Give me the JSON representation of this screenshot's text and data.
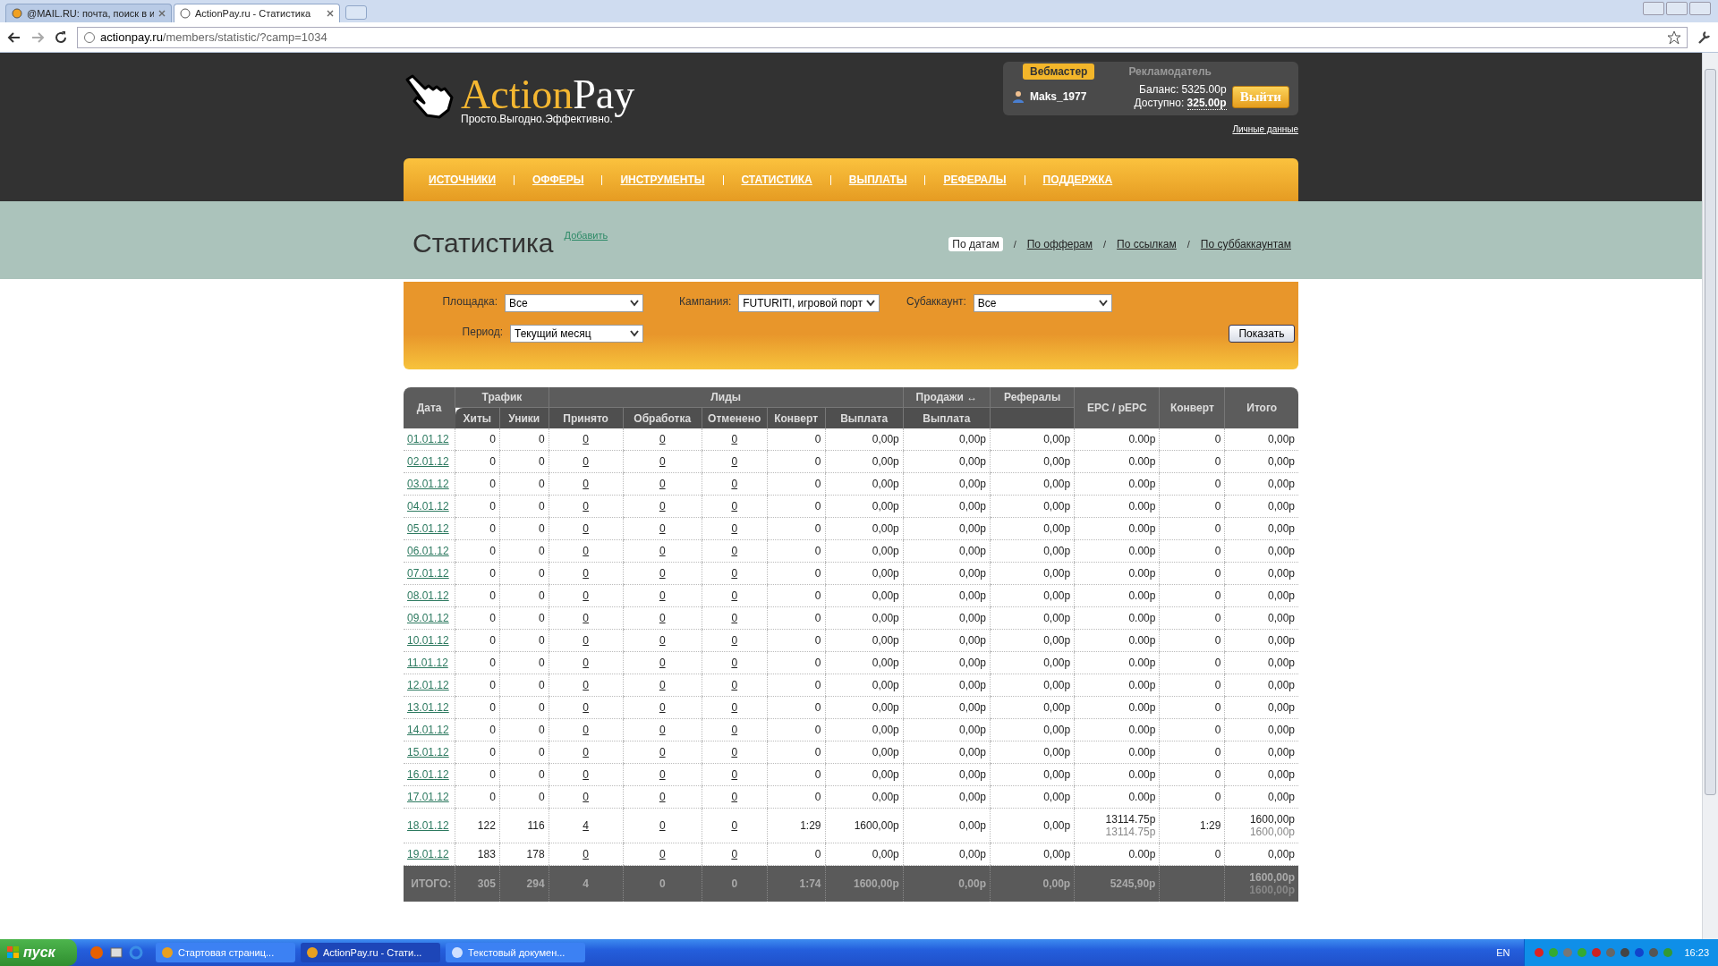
{
  "browser": {
    "tabs": [
      {
        "title": "@MAIL.RU: почта, поиск в и",
        "selected": false
      },
      {
        "title": "ActionPay.ru - Статистика",
        "selected": true
      }
    ],
    "url": {
      "host": "actionpay.ru",
      "path": "/members/statistic/?camp=1034"
    }
  },
  "header": {
    "logo": {
      "part1": "Action",
      "part2": "Pay",
      "tagline": "Просто.Выгодно.Эффективно."
    },
    "roles": [
      {
        "label": "Вебмастер",
        "selected": true
      },
      {
        "label": "Рекламодатель",
        "selected": false
      }
    ],
    "user": "Maks_1977",
    "balance_label": "Баланс:",
    "balance": "5325.00р",
    "available_label": "Доступно:",
    "available": "325.00р",
    "logout": "Выйти",
    "profile_link": "Личные данные"
  },
  "nav": [
    "ИСТОЧНИКИ",
    "ОФФЕРЫ",
    "ИНСТРУМЕНТЫ",
    "СТАТИСТИКА",
    "ВЫПЛАТЫ",
    "РЕФЕРАЛЫ",
    "ПОДДЕРЖКА"
  ],
  "page": {
    "title": "Статистика",
    "add_link": "Добавить",
    "separator": "/",
    "views": [
      {
        "label": "По датам",
        "selected": true
      },
      {
        "label": "По офферам",
        "selected": false
      },
      {
        "label": "По ссылкам",
        "selected": false
      },
      {
        "label": "По суббаккаунтам",
        "selected": false
      }
    ]
  },
  "filters": [
    {
      "label": "Площадка:",
      "value": "Все"
    },
    {
      "label": "Кампания:",
      "value": "FUTURITI, игровой порт"
    },
    {
      "label": "Субаккаунт:",
      "value": "Все"
    },
    {
      "label": "Период:",
      "value": "Текущий месяц"
    }
  ],
  "show_button": "Показать",
  "table": {
    "columns": [
      {
        "label": "Дата",
        "kind": "single"
      },
      {
        "label": "Трафик",
        "kind": "group",
        "children": [
          "Хиты",
          "Уники"
        ]
      },
      {
        "label": "Лиды",
        "kind": "group",
        "children": [
          "Принято",
          "Обработка",
          "Отменено",
          "Конверт",
          "Выплата"
        ]
      },
      {
        "label": "Продажи ↔",
        "kind": "group",
        "children": [
          "Выплата"
        ]
      },
      {
        "label": "Рефералы",
        "kind": "top"
      },
      {
        "label": "EPC / pEPC",
        "kind": "single"
      },
      {
        "label": "Конверт",
        "kind": "single"
      },
      {
        "label": "Итого",
        "kind": "single"
      }
    ],
    "rows": [
      {
        "date": "01.01.12",
        "hits": "0",
        "uniques": "0",
        "accepted": "0",
        "processing": "0",
        "cancelled": "0",
        "conv": "0",
        "payout": "0,00р",
        "sales_payout": "0,00р",
        "referrals": "0,00р",
        "epc": "0.00р",
        "conv2": "0",
        "total": "0,00р"
      },
      {
        "date": "02.01.12",
        "hits": "0",
        "uniques": "0",
        "accepted": "0",
        "processing": "0",
        "cancelled": "0",
        "conv": "0",
        "payout": "0,00р",
        "sales_payout": "0,00р",
        "referrals": "0,00р",
        "epc": "0.00р",
        "conv2": "0",
        "total": "0,00р"
      },
      {
        "date": "03.01.12",
        "hits": "0",
        "uniques": "0",
        "accepted": "0",
        "processing": "0",
        "cancelled": "0",
        "conv": "0",
        "payout": "0,00р",
        "sales_payout": "0,00р",
        "referrals": "0,00р",
        "epc": "0.00р",
        "conv2": "0",
        "total": "0,00р"
      },
      {
        "date": "04.01.12",
        "hits": "0",
        "uniques": "0",
        "accepted": "0",
        "processing": "0",
        "cancelled": "0",
        "conv": "0",
        "payout": "0,00р",
        "sales_payout": "0,00р",
        "referrals": "0,00р",
        "epc": "0.00р",
        "conv2": "0",
        "total": "0,00р"
      },
      {
        "date": "05.01.12",
        "hits": "0",
        "uniques": "0",
        "accepted": "0",
        "processing": "0",
        "cancelled": "0",
        "conv": "0",
        "payout": "0,00р",
        "sales_payout": "0,00р",
        "referrals": "0,00р",
        "epc": "0.00р",
        "conv2": "0",
        "total": "0,00р"
      },
      {
        "date": "06.01.12",
        "hits": "0",
        "uniques": "0",
        "accepted": "0",
        "processing": "0",
        "cancelled": "0",
        "conv": "0",
        "payout": "0,00р",
        "sales_payout": "0,00р",
        "referrals": "0,00р",
        "epc": "0.00р",
        "conv2": "0",
        "total": "0,00р"
      },
      {
        "date": "07.01.12",
        "hits": "0",
        "uniques": "0",
        "accepted": "0",
        "processing": "0",
        "cancelled": "0",
        "conv": "0",
        "payout": "0,00р",
        "sales_payout": "0,00р",
        "referrals": "0,00р",
        "epc": "0.00р",
        "conv2": "0",
        "total": "0,00р"
      },
      {
        "date": "08.01.12",
        "hits": "0",
        "uniques": "0",
        "accepted": "0",
        "processing": "0",
        "cancelled": "0",
        "conv": "0",
        "payout": "0,00р",
        "sales_payout": "0,00р",
        "referrals": "0,00р",
        "epc": "0.00р",
        "conv2": "0",
        "total": "0,00р"
      },
      {
        "date": "09.01.12",
        "hits": "0",
        "uniques": "0",
        "accepted": "0",
        "processing": "0",
        "cancelled": "0",
        "conv": "0",
        "payout": "0,00р",
        "sales_payout": "0,00р",
        "referrals": "0,00р",
        "epc": "0.00р",
        "conv2": "0",
        "total": "0,00р"
      },
      {
        "date": "10.01.12",
        "hits": "0",
        "uniques": "0",
        "accepted": "0",
        "processing": "0",
        "cancelled": "0",
        "conv": "0",
        "payout": "0,00р",
        "sales_payout": "0,00р",
        "referrals": "0,00р",
        "epc": "0.00р",
        "conv2": "0",
        "total": "0,00р"
      },
      {
        "date": "11.01.12",
        "hits": "0",
        "uniques": "0",
        "accepted": "0",
        "processing": "0",
        "cancelled": "0",
        "conv": "0",
        "payout": "0,00р",
        "sales_payout": "0,00р",
        "referrals": "0,00р",
        "epc": "0.00р",
        "conv2": "0",
        "total": "0,00р"
      },
      {
        "date": "12.01.12",
        "hits": "0",
        "uniques": "0",
        "accepted": "0",
        "processing": "0",
        "cancelled": "0",
        "conv": "0",
        "payout": "0,00р",
        "sales_payout": "0,00р",
        "referrals": "0,00р",
        "epc": "0.00р",
        "conv2": "0",
        "total": "0,00р"
      },
      {
        "date": "13.01.12",
        "hits": "0",
        "uniques": "0",
        "accepted": "0",
        "processing": "0",
        "cancelled": "0",
        "conv": "0",
        "payout": "0,00р",
        "sales_payout": "0,00р",
        "referrals": "0,00р",
        "epc": "0.00р",
        "conv2": "0",
        "total": "0,00р"
      },
      {
        "date": "14.01.12",
        "hits": "0",
        "uniques": "0",
        "accepted": "0",
        "processing": "0",
        "cancelled": "0",
        "conv": "0",
        "payout": "0,00р",
        "sales_payout": "0,00р",
        "referrals": "0,00р",
        "epc": "0.00р",
        "conv2": "0",
        "total": "0,00р"
      },
      {
        "date": "15.01.12",
        "hits": "0",
        "uniques": "0",
        "accepted": "0",
        "processing": "0",
        "cancelled": "0",
        "conv": "0",
        "payout": "0,00р",
        "sales_payout": "0,00р",
        "referrals": "0,00р",
        "epc": "0.00р",
        "conv2": "0",
        "total": "0,00р"
      },
      {
        "date": "16.01.12",
        "hits": "0",
        "uniques": "0",
        "accepted": "0",
        "processing": "0",
        "cancelled": "0",
        "conv": "0",
        "payout": "0,00р",
        "sales_payout": "0,00р",
        "referrals": "0,00р",
        "epc": "0.00р",
        "conv2": "0",
        "total": "0,00р"
      },
      {
        "date": "17.01.12",
        "hits": "0",
        "uniques": "0",
        "accepted": "0",
        "processing": "0",
        "cancelled": "0",
        "conv": "0",
        "payout": "0,00р",
        "sales_payout": "0,00р",
        "referrals": "0,00р",
        "epc": "0.00р",
        "conv2": "0",
        "total": "0,00р"
      },
      {
        "date": "18.01.12",
        "hits": "122",
        "uniques": "116",
        "accepted": "4",
        "processing": "0",
        "cancelled": "0",
        "conv": "1:29",
        "payout": "1600,00р",
        "sales_payout": "0,00р",
        "referrals": "0,00р",
        "epc": "13114.75р",
        "epc_sub": "13114.75р",
        "conv2": "1:29",
        "total": "1600,00р",
        "total_sub": "1600,00р"
      },
      {
        "date": "19.01.12",
        "hits": "183",
        "uniques": "178",
        "accepted": "0",
        "processing": "0",
        "cancelled": "0",
        "conv": "0",
        "payout": "0,00р",
        "sales_payout": "0,00р",
        "referrals": "0,00р",
        "epc": "0.00р",
        "conv2": "0",
        "total": "0,00р"
      }
    ],
    "footer": {
      "label": "ИТОГО:",
      "hits": "305",
      "uniques": "294",
      "accepted": "4",
      "processing": "0",
      "cancelled": "0",
      "conv": "1:74",
      "payout": "1600,00р",
      "sales_payout": "0,00р",
      "referrals": "0,00р",
      "epc": "5245,90р",
      "total": "1600,00р",
      "total_sub": "1600,00р"
    }
  },
  "taskbar": {
    "start": "пуск",
    "tasks": [
      {
        "label": "Стартовая страниц...",
        "selected": false
      },
      {
        "label": "ActionPay.ru - Стати...",
        "selected": true
      },
      {
        "label": "Текстовый докумен...",
        "selected": false
      }
    ],
    "language": "EN",
    "time": "16:23"
  }
}
